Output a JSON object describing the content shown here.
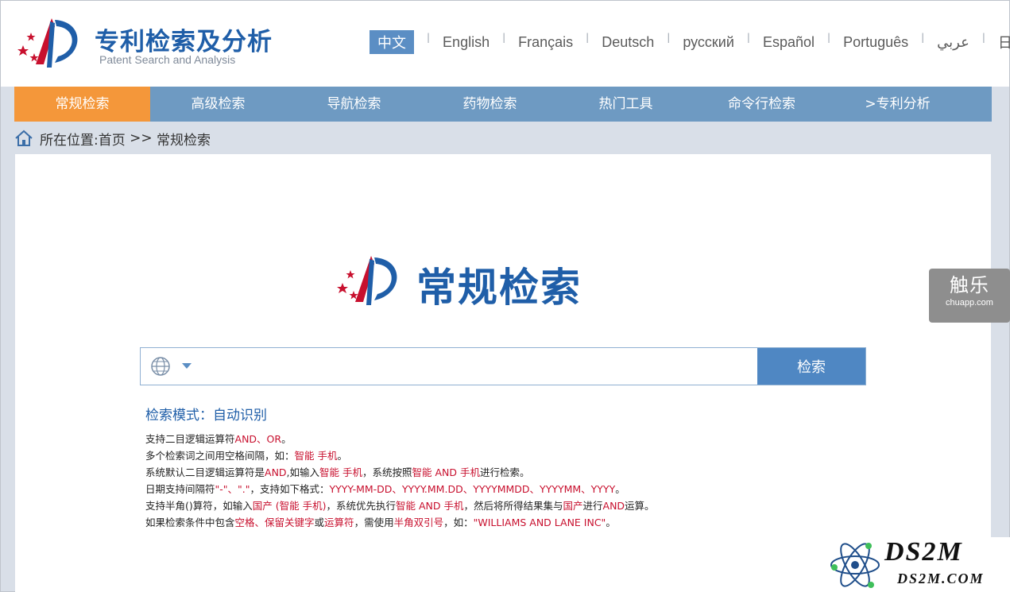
{
  "header": {
    "title": "专利检索及分析",
    "subtitle": "Patent Search and Analysis"
  },
  "languages": [
    {
      "label": "中文",
      "active": true
    },
    {
      "label": "English"
    },
    {
      "label": "Français"
    },
    {
      "label": "Deutsch"
    },
    {
      "label": "русский"
    },
    {
      "label": "Español"
    },
    {
      "label": "Português"
    },
    {
      "label": "عربي"
    },
    {
      "label": "日本語"
    }
  ],
  "nav": [
    {
      "label": "常规检索",
      "active": true
    },
    {
      "label": "高级检索"
    },
    {
      "label": "导航检索"
    },
    {
      "label": "药物检索"
    },
    {
      "label": "热门工具"
    },
    {
      "label": "命令行检索"
    },
    {
      "label": ">专利分析"
    }
  ],
  "breadcrumb": {
    "prefix": "所在位置: ",
    "home": "首页",
    "sep": " >> ",
    "current": "常规检索"
  },
  "main": {
    "title": "常规检索",
    "search": {
      "placeholder": "",
      "value": "",
      "button": "检索"
    },
    "mode": "检索模式：自动识别",
    "tips": {
      "l1a": "支持二目逻辑运算符",
      "l1b": "AND、OR",
      "l1c": "。",
      "l2a": "多个检索词之间用空格间隔，如：",
      "l2b": "智能 手机",
      "l2c": "。",
      "l3a": "系统默认二目逻辑运算符是",
      "l3b": "AND",
      "l3c": ",如输入",
      "l3d": "智能 手机",
      "l3e": "，系统按照",
      "l3f": "智能 AND 手机",
      "l3g": "进行检索。",
      "l4a": "日期支持间隔符",
      "l4b": "\"-\"、\".\"",
      "l4c": "，支持如下格式：",
      "l4d": "YYYY-MM-DD、YYYY.MM.DD、YYYYMMDD、YYYYMM、YYYY",
      "l4e": "。",
      "l5a": "支持半角()算符，如输入",
      "l5b": "国产 (智能 手机)",
      "l5c": "，系统优先执行",
      "l5d": "智能 AND 手机",
      "l5e": "，然后将所得结果集与",
      "l5f": "国产",
      "l5g": "进行",
      "l5h": "AND",
      "l5i": "运算。",
      "l6a": "如果检索条件中包含",
      "l6b": "空格、保留关键字",
      "l6c": "或",
      "l6d": "运算符",
      "l6e": "，需使用",
      "l6f": "半角双引号",
      "l6g": "，如：",
      "l6h": "\"WILLIAMS AND LANE INC\"",
      "l6i": "。"
    }
  },
  "side_widget": {
    "title": "触乐",
    "url": "chuapp.com"
  },
  "watermark": {
    "big": "DS2M",
    "small": "DS2M.COM"
  },
  "colors": {
    "brand_blue": "#1f5ea8",
    "nav_bg": "#6e9ac2",
    "nav_active": "#f4973a",
    "highlight_red": "#c8102e",
    "button_blue": "#4f87c3"
  }
}
